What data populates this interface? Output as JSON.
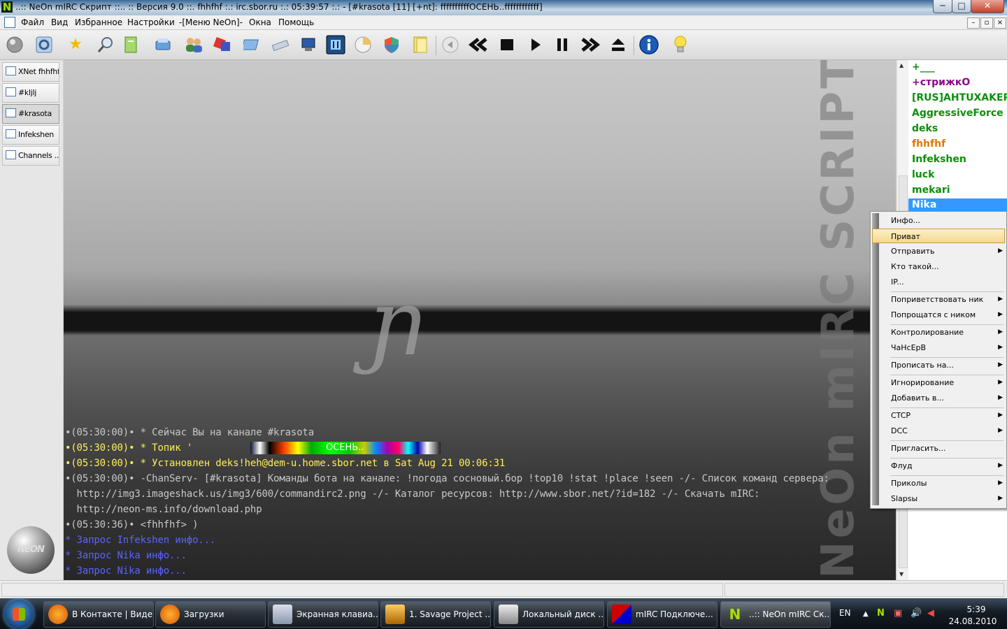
{
  "window": {
    "title": "..:: NeOn mIRC Скрипт ::.. :: Версия 9.0 ::. fhhfhf :.: irc.sbor.ru :.: 05:39:57 :.: - [#krasota [11] [+nt]: ffffffffffОСЕНЬ..ffffffffffff]",
    "minimize": "─",
    "maximize": "□",
    "close": "✕"
  },
  "menu": {
    "items": [
      "Файл",
      "Вид",
      "Избранное",
      "Настройки",
      "-[Меню NeOn]-",
      "Окна",
      "Помощь"
    ],
    "mdi_minimize": "–",
    "mdi_restore": "▫",
    "mdi_close": "×"
  },
  "toolbar": {
    "icons": [
      "connect-icon",
      "options-icon",
      "favorites-icon",
      "search-icon",
      "address-book-icon",
      "send-icon",
      "users-icon",
      "notify-icon",
      "list-channels-icon",
      "dcc-icon",
      "network-icon",
      "finder-icon",
      "timer-icon",
      "shield-icon",
      "folder-icon",
      "back-icon",
      "rewind-icon",
      "stop-icon",
      "play-icon",
      "pause-icon",
      "forward-icon",
      "eject-icon",
      "info-icon",
      "tip-icon"
    ]
  },
  "switchbar": {
    "items": [
      "XNet fhhfhf",
      "#kljlj",
      "#krasota",
      "Infekshen",
      "Channels ..."
    ],
    "active": "#krasota",
    "logo": "NEON"
  },
  "chat": {
    "watermark_symbol": "ɲ",
    "side_watermark": "NeOn mIRC SCRIPT",
    "lines": [
      "•(05:30:00)• * Сейчас Вы на канале #krasota",
      "•(05:30:00)• * Топик '",
      "•(05:30:00)• * Установлен deks!heh@dem-u.home.sbor.net в Sat Aug 21 00:06:31",
      "•(05:30:00)• -ChanServ- [#krasota] Команды бота на канале: !погода сосновый.бор !top10 !stat !place !seen -/- Список команд сервера:",
      "  http://img3.imageshack.us/img3/600/commandirc2.png -/- Каталог ресурсов: http://www.sbor.net/?id=182 -/- Скачать mIRC:",
      "  http://neon-ms.info/download.php",
      "•(05:30:36)• <fhhfhf> )",
      "* Запрос Infekshen инфо...",
      "* Запрос Nika инфо...",
      "* Запрос Nika инфо..."
    ],
    "topic_word": "ОСЕНЬ.."
  },
  "nicklist": {
    "nicks": [
      "+___",
      "+стрижкО",
      "[RUS]AHTUXAKEP",
      "AggressiveForce",
      "deks",
      "fhhfhf",
      "Infekshen",
      "luck",
      "mekari",
      "Nika"
    ],
    "selected": "Nika"
  },
  "context_menu": {
    "items": [
      "Инфо...",
      "Приват",
      "Отправить",
      "Кто такой...",
      "IP...",
      "Поприветствовать ник",
      "Попрощатся с ником",
      "Контролирование",
      "ЧаНсЕрВ",
      "Прописать на...",
      "Игнорирование",
      "Добавить в...",
      "CTCP",
      "DCC",
      "Пригласить...",
      "Флуд",
      "Приколы",
      "Slapsы"
    ],
    "highlighted": "Приват",
    "submenu_arrow": "▶"
  },
  "taskbar": {
    "tasks": [
      "В Контакте | Виде...",
      "Загрузки",
      "Экранная клавиа...",
      "1. Savage Project ...",
      "Локальный диск ...",
      "mIRC Подключе...",
      "..:: NeOn mIRC Ск..."
    ],
    "tray_lang": "EN",
    "time": "5:39",
    "date": "24.08.2010"
  },
  "colors": {
    "nick_green": "#0b8f0b",
    "nick_purple": "#8a0a8a",
    "nick_orange": "#e07800",
    "chat_yellow": "#ffef5a",
    "chat_blue": "#5a63ff",
    "selection": "#3399ff"
  }
}
